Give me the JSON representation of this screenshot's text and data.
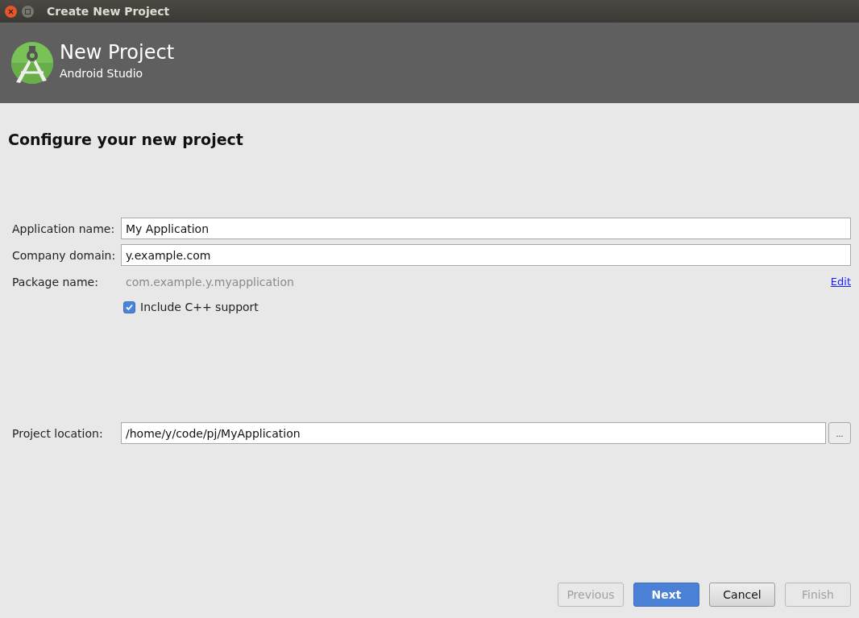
{
  "window": {
    "title": "Create New Project"
  },
  "header": {
    "title": "New Project",
    "subtitle": "Android Studio"
  },
  "page_title": "Configure your new project",
  "fields": [
    {
      "label": "Application name:",
      "value": "My Application"
    },
    {
      "label": "Company domain:",
      "value": "y.example.com"
    }
  ],
  "package": {
    "label": "Package name:",
    "value": "com.example.y.myapplication",
    "link": "Edit"
  },
  "cpp_support": {
    "label": "Include C++ support",
    "checked": true
  },
  "location": {
    "label": "Project location:",
    "value": "/home/y/code/pj/MyApplication",
    "browse": "..."
  },
  "buttons": [
    {
      "label": "Previous",
      "kind": "plain",
      "disabled": true
    },
    {
      "label": "Next",
      "kind": "primary",
      "disabled": false
    },
    {
      "label": "Cancel",
      "kind": "plain",
      "disabled": false
    },
    {
      "label": "Finish",
      "kind": "plain",
      "disabled": true
    }
  ]
}
